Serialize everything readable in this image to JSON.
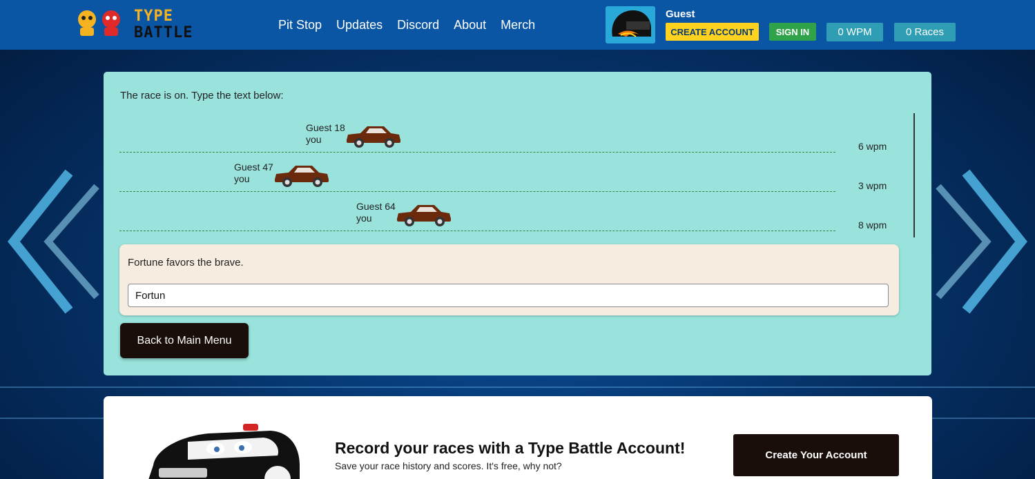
{
  "header": {
    "logo": {
      "line1": "TYPE",
      "line2": "BATTLE"
    },
    "nav": [
      "Pit Stop",
      "Updates",
      "Discord",
      "About",
      "Merch"
    ],
    "user": {
      "name": "Guest",
      "create_account": "CREATE ACCOUNT",
      "sign_in": "SIGN IN",
      "wpm": "0 WPM",
      "races": "0 Races"
    }
  },
  "race": {
    "prompt": "The race is on. Type the text below:",
    "racers": [
      {
        "name": "Guest 18",
        "tag": "you",
        "wpm": "6 wpm",
        "progress": 0.27
      },
      {
        "name": "Guest 47",
        "tag": "you",
        "wpm": "3 wpm",
        "progress": 0.17
      },
      {
        "name": "Guest 64",
        "tag": "you",
        "wpm": "8 wpm",
        "progress": 0.34
      }
    ],
    "car_color": "#6b2a0c",
    "sentence": "Fortune favors the brave.",
    "input_value": "Fortun",
    "back_button": "Back to Main Menu"
  },
  "promo": {
    "title": "Record your races with a Type Battle Account!",
    "subtitle": "Save your race history and scores. It's free, why not?",
    "button": "Create Your Account"
  }
}
